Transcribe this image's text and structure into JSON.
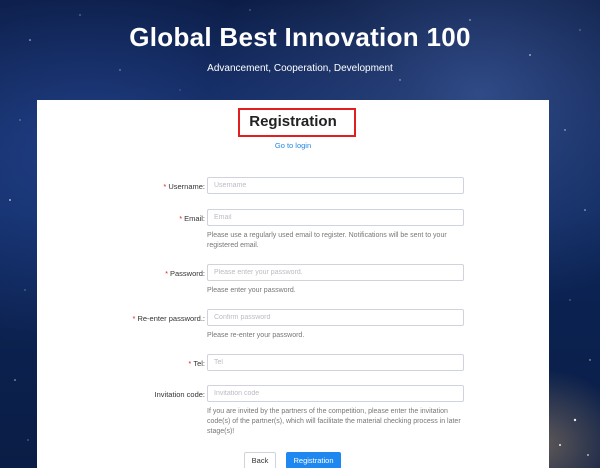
{
  "header": {
    "title": "Global Best Innovation 100",
    "subtitle": "Advancement, Cooperation, Development"
  },
  "form": {
    "heading": "Registration",
    "login_link": "Go to login",
    "username": {
      "label": "Username:",
      "placeholder": "Username",
      "required": true
    },
    "email": {
      "label": "Email:",
      "placeholder": "Email",
      "required": true,
      "help": "Please use a regularly used email to register. Notifications will be sent to your registered email."
    },
    "password": {
      "label": "Password:",
      "placeholder": "Please enter your password.",
      "required": true,
      "help": "Please enter your password."
    },
    "reenter": {
      "label": "Re-enter password.:",
      "placeholder": "Confirm password",
      "required": true,
      "help": "Please re-enter your password."
    },
    "tel": {
      "label": "Tel:",
      "placeholder": "Tel",
      "required": true
    },
    "invitation": {
      "label": "Invitation code:",
      "placeholder": "Invitation code",
      "required": false,
      "help": "If you are invited by the partners of the competition, please enter the invitation code(s) of the partner(s), which will facilitate the material checking process in later stage(s)!"
    },
    "required_marker": "*",
    "back_label": "Back",
    "submit_label": "Registration"
  },
  "colors": {
    "accent": "#1e88f0",
    "required": "#e02020",
    "highlight_box": "#e02020"
  }
}
